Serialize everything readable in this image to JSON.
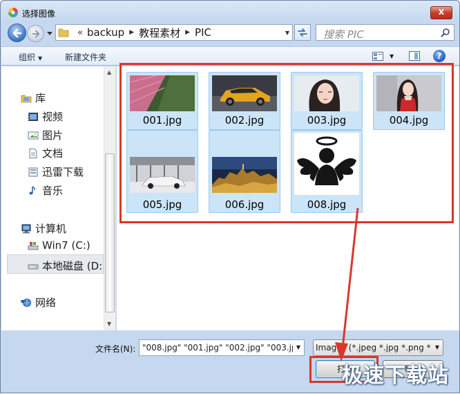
{
  "window": {
    "title": "选择图像",
    "close_glyph": "x"
  },
  "address": {
    "chevrons": "«",
    "crumbs": [
      "backup",
      "教程素材",
      "PIC"
    ]
  },
  "search": {
    "placeholder": "搜索 PIC"
  },
  "toolbar": {
    "organize_label": "组织",
    "new_folder_label": "新建文件夹",
    "help_glyph": "?"
  },
  "navpane": {
    "items": [
      {
        "label": "库",
        "icon": "library-icon"
      },
      {
        "label": "视频",
        "icon": "video-icon"
      },
      {
        "label": "图片",
        "icon": "pictures-icon"
      },
      {
        "label": "文档",
        "icon": "documents-icon"
      },
      {
        "label": "迅雷下载",
        "icon": "download-folder-icon"
      },
      {
        "label": "音乐",
        "icon": "music-icon"
      },
      {
        "label": "计算机",
        "icon": "computer-icon"
      },
      {
        "label": "Win7 (C:)",
        "icon": "system-drive-icon"
      },
      {
        "label": "本地磁盘 (D:",
        "icon": "drive-icon"
      },
      {
        "label": "网络",
        "icon": "network-icon"
      }
    ],
    "selected": "本地磁盘 (D:"
  },
  "files": [
    {
      "name": "001.jpg",
      "thumb": "aerial-field"
    },
    {
      "name": "002.jpg",
      "thumb": "yellow-suv"
    },
    {
      "name": "003.jpg",
      "thumb": "portrait"
    },
    {
      "name": "004.jpg",
      "thumb": "portrait-red"
    },
    {
      "name": "005.jpg",
      "thumb": "white-car-showroom"
    },
    {
      "name": "006.jpg",
      "thumb": "night-city"
    },
    {
      "name": "008.jpg",
      "thumb": "angel-icon"
    }
  ],
  "filename": {
    "label": "文件名(N):",
    "value": "\"008.jpg\" \"001.jpg\" \"002.jpg\" \"003.jpg"
  },
  "filter": {
    "value": "Images (*.jpeg *.jpg *.png *."
  },
  "buttons": {
    "open": "打开",
    "cancel": "取消"
  },
  "watermark": "极速下载站",
  "colors": {
    "highlight": "#d9372a",
    "selection": "#cce4f7",
    "accent": "#3a74c4"
  }
}
